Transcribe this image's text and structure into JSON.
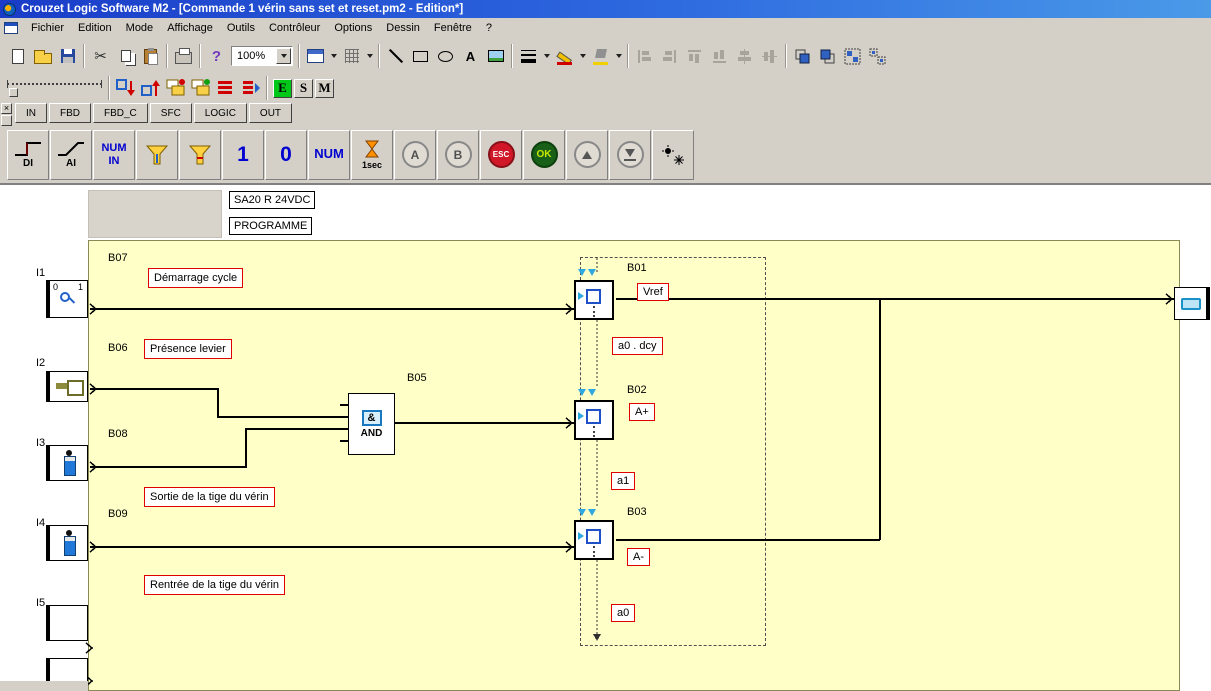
{
  "window": {
    "title": "Crouzet Logic Software M2 - [Commande 1 vérin sans set et reset.pm2 - Edition*]"
  },
  "menubar": {
    "items": [
      "Fichier",
      "Edition",
      "Mode",
      "Affichage",
      "Outils",
      "Contrôleur",
      "Options",
      "Dessin",
      "Fenêtre",
      "?"
    ]
  },
  "toolbars": {
    "zoom": "100%",
    "modes": {
      "edit": "E",
      "simulation": "S",
      "monitoring": "M"
    }
  },
  "icons": {
    "help_glyph": "?",
    "text_tool_glyph": "A",
    "cut_glyph": "✂",
    "close_glyph": "×"
  },
  "tabs": {
    "items": [
      "IN",
      "FBD",
      "FBD_C",
      "SFC",
      "LOGIC",
      "OUT"
    ]
  },
  "palette": {
    "di": "DI",
    "ai": "AI",
    "num_in": "NUM\nIN",
    "const_one": "1",
    "const_zero": "0",
    "num": "NUM",
    "timer": "1sec",
    "key_a": "A",
    "key_b": "B",
    "key_esc": "ESC",
    "key_ok": "OK"
  },
  "canvas": {
    "device_label": "SA20 R 24VDC",
    "program_label": "PROGRAMME",
    "inputs": [
      {
        "id": "I1",
        "icon_zero": "0",
        "icon_one": "1"
      },
      {
        "id": "I2"
      },
      {
        "id": "I3"
      },
      {
        "id": "I4"
      },
      {
        "id": "I5"
      }
    ],
    "blocks": {
      "b07": {
        "id": "B07",
        "comment": "Démarrage cycle"
      },
      "b06": {
        "id": "B06",
        "comment": "Présence levier"
      },
      "b08": {
        "id": "B08",
        "comment": "Sortie de la tige du vérin"
      },
      "b09": {
        "id": "B09",
        "comment": "Rentrée de la tige du vérin"
      },
      "b05": {
        "id": "B05",
        "symbol": "&",
        "label": "AND"
      },
      "b01": {
        "id": "B01",
        "tag": "Vref",
        "transition": "a0 . dcy"
      },
      "b02": {
        "id": "B02",
        "tag": "A+",
        "transition": "a1"
      },
      "b03": {
        "id": "B03",
        "tag": "A-",
        "transition": "a0"
      }
    }
  },
  "colors": {
    "canvas_bg": "#ffffc8",
    "comment_border": "#e00000",
    "wire": "#000000",
    "step_arrow": "#2fa8e0",
    "mode_active": "#00c818",
    "title_bar_left": "#1a3cc8",
    "title_bar_right": "#4a9ae8"
  }
}
